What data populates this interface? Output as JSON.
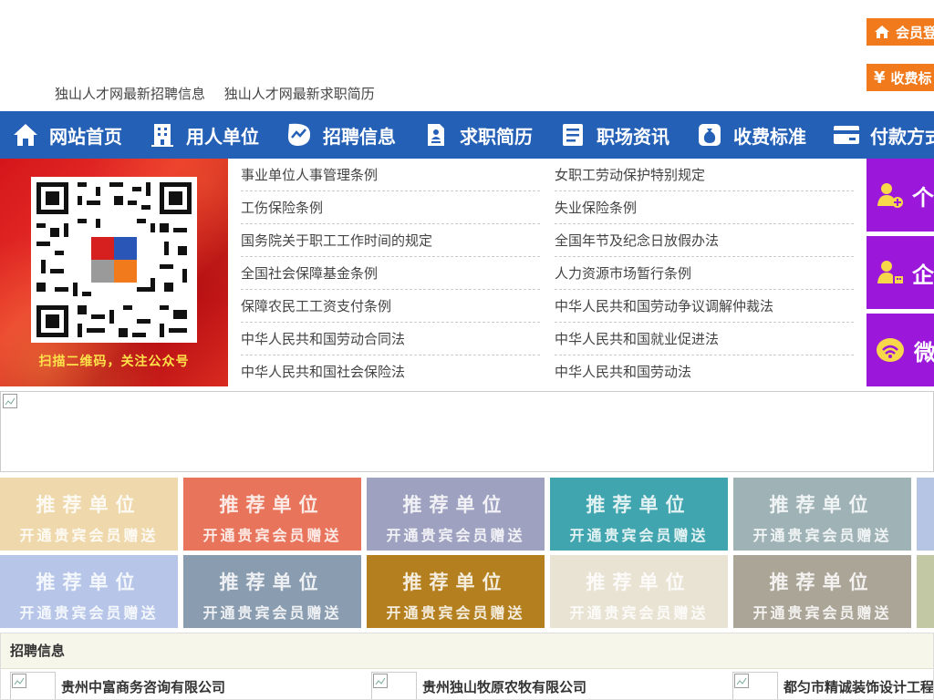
{
  "header": {
    "top_links": [
      "独山人才网最新招聘信息",
      "独山人才网最新求职简历"
    ],
    "login_label": "会员登",
    "fee_label": "收费标",
    "fee_symbol": "¥"
  },
  "nav": [
    {
      "label": "网站首页",
      "icon": "home-icon"
    },
    {
      "label": "用人单位",
      "icon": "building-icon"
    },
    {
      "label": "招聘信息",
      "icon": "chart-icon"
    },
    {
      "label": "求职简历",
      "icon": "resume-icon"
    },
    {
      "label": "职场资讯",
      "icon": "news-icon"
    },
    {
      "label": "收费标准",
      "icon": "money-bag-icon"
    },
    {
      "label": "付款方式",
      "icon": "card-icon"
    }
  ],
  "qr": {
    "caption": "扫描二维码，关注公众号"
  },
  "laws": [
    [
      "事业单位人事管理条例",
      "女职工劳动保护特别规定"
    ],
    [
      "工伤保险条例",
      "失业保险条例"
    ],
    [
      "国务院关于职工工作时间的规定",
      "全国年节及纪念日放假办法"
    ],
    [
      "全国社会保障基金条例",
      "人力资源市场暂行条例"
    ],
    [
      "保障农民工工资支付条例",
      "中华人民共和国劳动争议调解仲裁法"
    ],
    [
      "中华人民共和国劳动合同法",
      "中华人民共和国就业促进法"
    ],
    [
      "中华人民共和国社会保险法",
      "中华人民共和国劳动法"
    ]
  ],
  "side_tiles": [
    {
      "label": "个",
      "icon": "person-add-icon"
    },
    {
      "label": "企",
      "icon": "company-user-icon"
    },
    {
      "label": "微",
      "icon": "wechat-icon"
    }
  ],
  "recommend": {
    "line1": "推荐单位",
    "line2": "开通贵宾会员赠送",
    "colors": [
      "#efd9ac",
      "#e8755b",
      "#9ea2c0",
      "#40a5ae",
      "#9fb3b7",
      "#b6c5e3",
      "#b7c6e8",
      "#8a9db0",
      "#b4801f",
      "#e9e3d3",
      "#aba597",
      "#c2c8a3"
    ]
  },
  "jobs": {
    "title": "招聘信息",
    "items": [
      "贵州中富商务咨询有限公司",
      "贵州独山牧原农牧有限公司",
      "都匀市精诚装饰设计工程"
    ]
  }
}
